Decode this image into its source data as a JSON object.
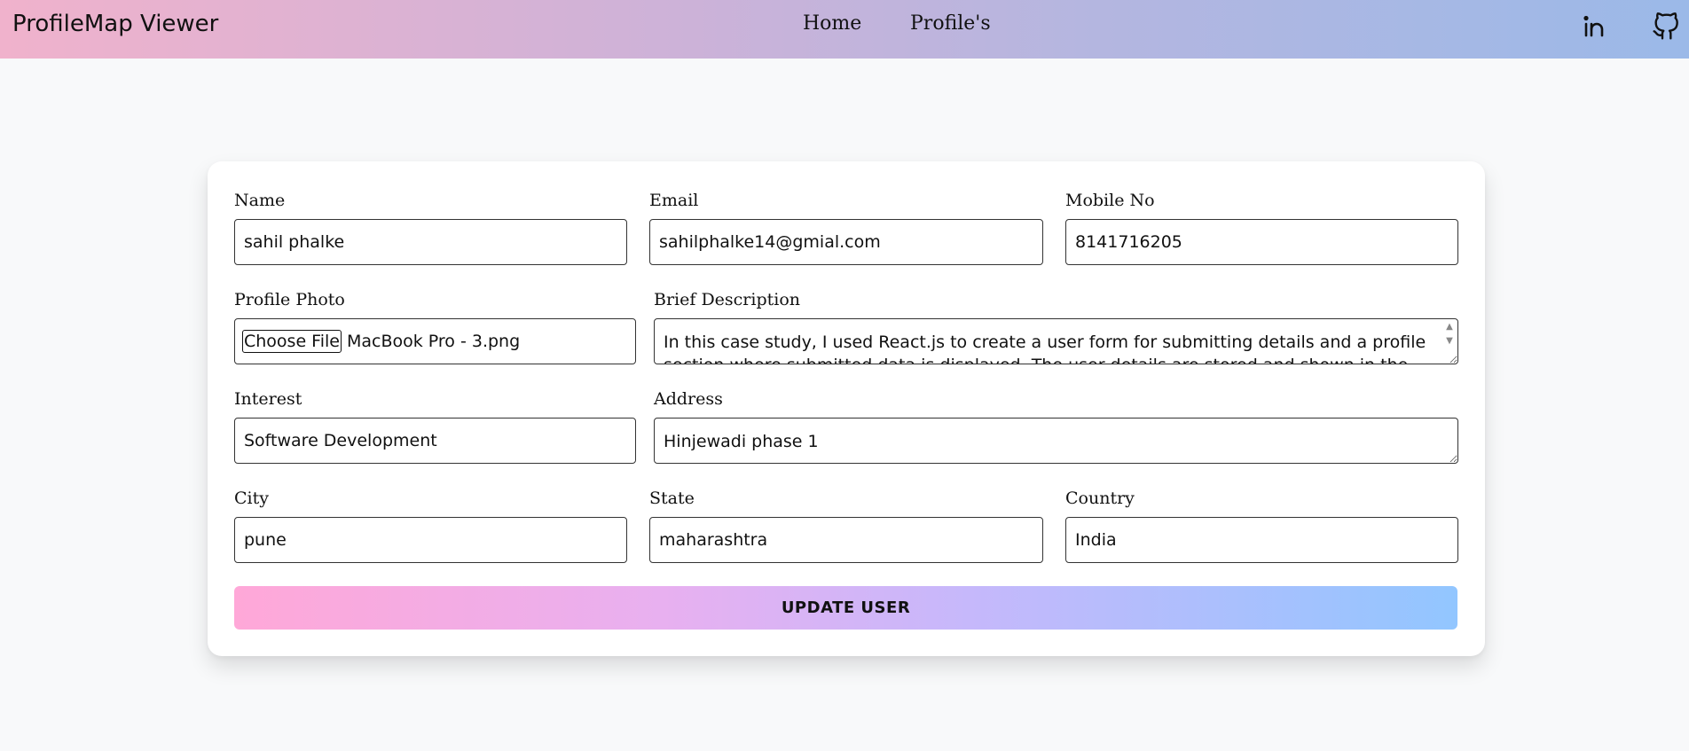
{
  "app": {
    "title": "ProfileMap Viewer"
  },
  "nav": {
    "home": "Home",
    "profiles": "Profile's"
  },
  "icons": {
    "linkedin": "linkedin-icon",
    "github": "github-icon"
  },
  "form": {
    "name": {
      "label": "Name",
      "value": "sahil phalke"
    },
    "email": {
      "label": "Email",
      "value": "sahilphalke14@gmial.com"
    },
    "mobile": {
      "label": "Mobile No",
      "value": "8141716205"
    },
    "photo": {
      "label": "Profile Photo",
      "button": "Choose File",
      "file": "MacBook Pro - 3.png"
    },
    "description": {
      "label": "Brief Description",
      "value": "In this case study, I used React.js to create a user form for submitting details and a profile section where submitted data is displayed. The user details are stored and shown in the profile"
    },
    "interest": {
      "label": "Interest",
      "value": "Software Development"
    },
    "address": {
      "label": "Address",
      "value": "Hinjewadi phase 1"
    },
    "city": {
      "label": "City",
      "value": "pune"
    },
    "state": {
      "label": "State",
      "value": "maharashtra"
    },
    "country": {
      "label": "Country",
      "value": "India"
    },
    "submit": "UPDATE USER"
  },
  "colors": {
    "nav_start": "#f0b2cc",
    "nav_end": "#9bb9e8",
    "button_start": "#ffa8d8",
    "button_end": "#92c6ff"
  }
}
